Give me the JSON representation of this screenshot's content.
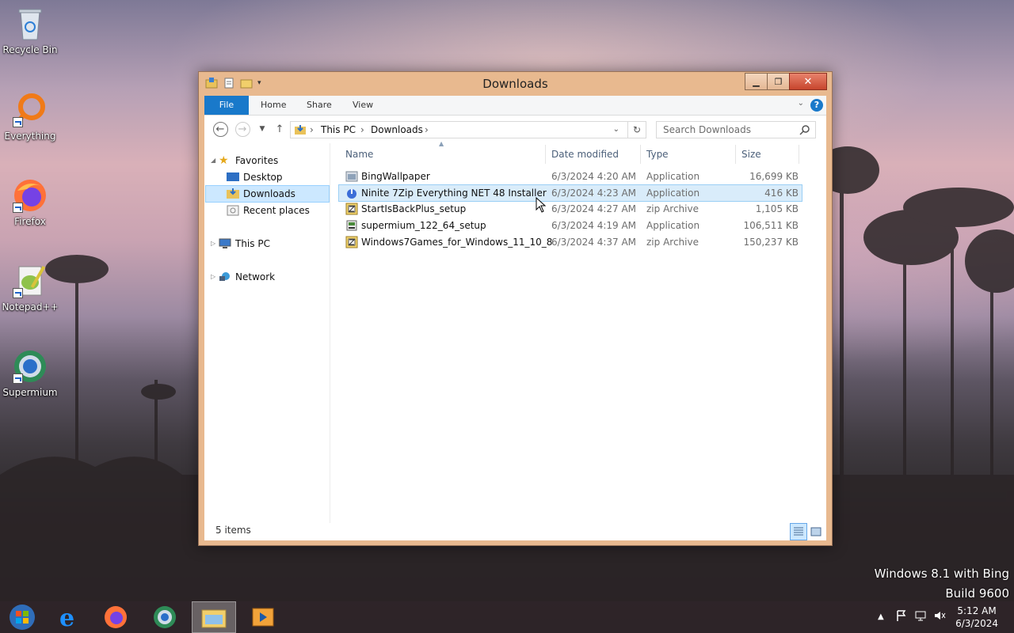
{
  "desktop": {
    "icons": [
      {
        "label": "Recycle Bin",
        "icon": "recycle-bin-icon"
      },
      {
        "label": "Everything",
        "icon": "everything-search-icon"
      },
      {
        "label": "Firefox",
        "icon": "firefox-icon"
      },
      {
        "label": "Notepad++",
        "icon": "notepad-plus-plus-icon"
      },
      {
        "label": "Supermium",
        "icon": "supermium-icon"
      }
    ],
    "watermark": {
      "line1": "Windows 8.1 with Bing",
      "line2": "Build 9600"
    }
  },
  "window": {
    "title": "Downloads",
    "ribbon_tabs": [
      "File",
      "Home",
      "Share",
      "View"
    ],
    "address": {
      "segments": [
        "This PC",
        "Downloads"
      ]
    },
    "search_placeholder": "Search Downloads",
    "nav": {
      "favorites": "Favorites",
      "desktop": "Desktop",
      "downloads": "Downloads",
      "recent": "Recent places",
      "this_pc": "This PC",
      "network": "Network"
    },
    "columns": [
      "Name",
      "Date modified",
      "Type",
      "Size"
    ],
    "files": [
      {
        "name": "BingWallpaper",
        "date": "6/3/2024 4:20 AM",
        "type": "Application",
        "size": "16,699 KB",
        "icon": "application-icon",
        "selected": false
      },
      {
        "name": "Ninite 7Zip Everything NET 48 Installer",
        "date": "6/3/2024 4:23 AM",
        "type": "Application",
        "size": "416 KB",
        "icon": "ninite-icon",
        "selected": true
      },
      {
        "name": "StartIsBackPlus_setup",
        "date": "6/3/2024 4:27 AM",
        "type": "zip Archive",
        "size": "1,105 KB",
        "icon": "zip-archive-icon",
        "selected": false
      },
      {
        "name": "supermium_122_64_setup",
        "date": "6/3/2024 4:19 AM",
        "type": "Application",
        "size": "106,511 KB",
        "icon": "installer-icon",
        "selected": false
      },
      {
        "name": "Windows7Games_for_Windows_11_10_8",
        "date": "6/3/2024 4:37 AM",
        "type": "zip Archive",
        "size": "150,237 KB",
        "icon": "zip-archive-icon",
        "selected": false
      }
    ],
    "status": "5 items"
  },
  "taskbar": {
    "items": [
      "start-button",
      "internet-explorer",
      "firefox",
      "supermium",
      "file-explorer",
      "media-player"
    ],
    "clock": {
      "time": "5:12 AM",
      "date": "6/3/2024"
    }
  },
  "colors": {
    "accent": "#1979ca",
    "window_frame": "#e8b98f",
    "selection": "#d9ecfa"
  }
}
